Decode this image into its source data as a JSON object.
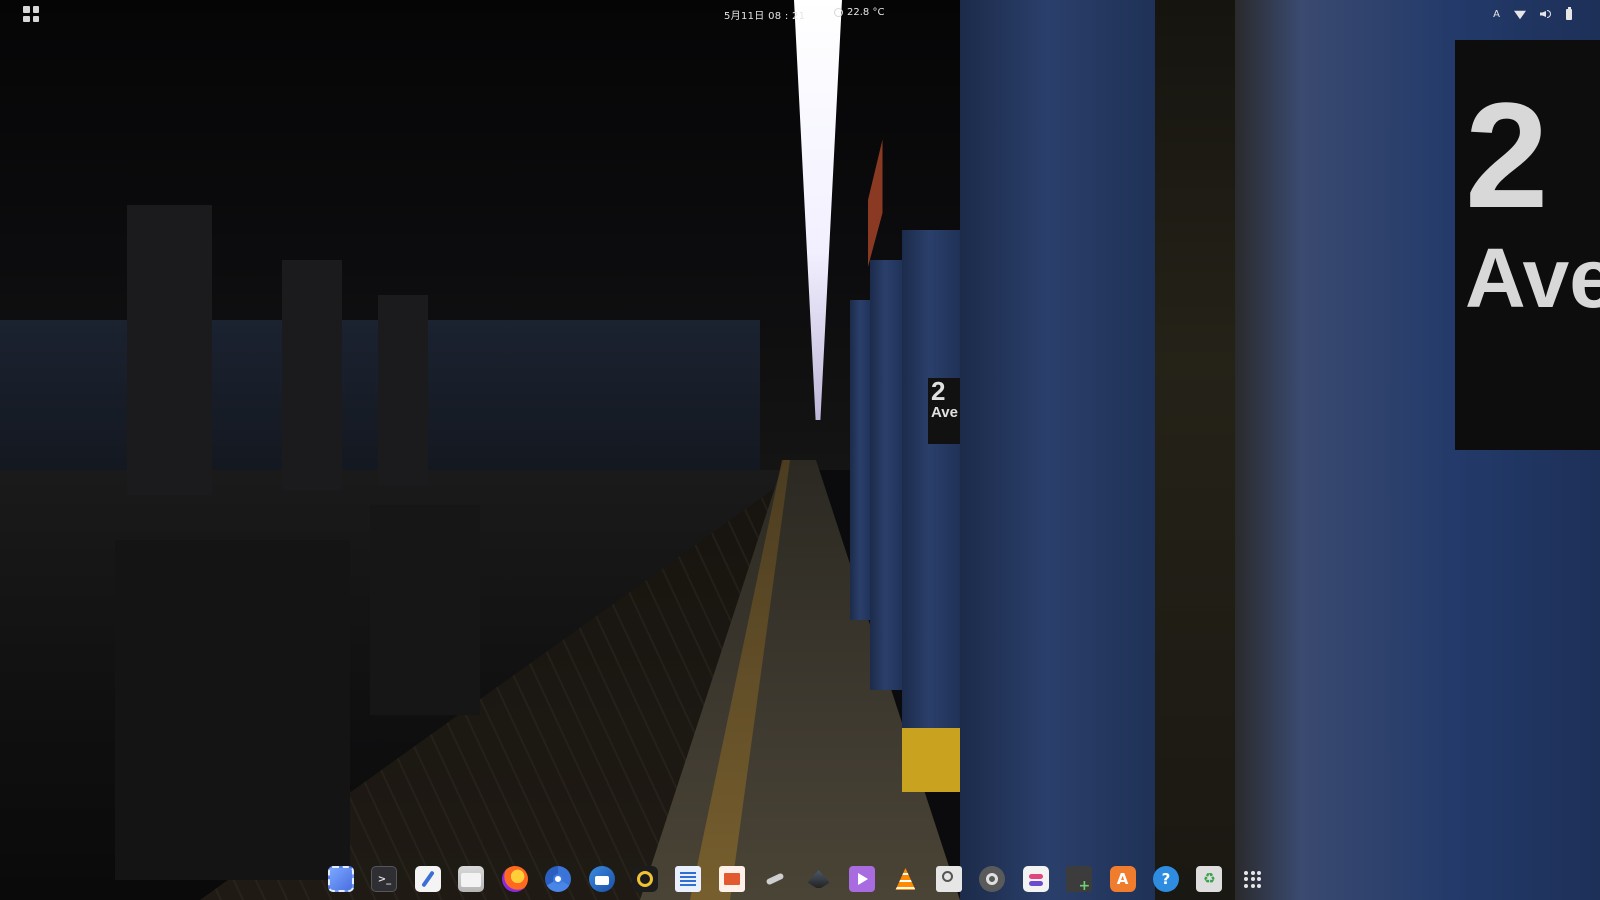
{
  "topbar": {
    "clock": "5月11日 08 : 21",
    "weather_temp": "22.8 °C",
    "weather_icon": "weather-icon",
    "input_method": "A",
    "tray_icons": [
      "wifi-icon",
      "volume-icon",
      "battery-icon"
    ]
  },
  "wallpaper": {
    "sign_number": "2",
    "sign_text": "Ave"
  },
  "dock": {
    "items": [
      {
        "name": "screenshot-icon"
      },
      {
        "name": "terminal-icon",
        "glyph": ">_"
      },
      {
        "name": "text-editor-icon"
      },
      {
        "name": "files-icon"
      },
      {
        "name": "firefox-icon"
      },
      {
        "name": "chromium-icon"
      },
      {
        "name": "thunderbird-icon"
      },
      {
        "name": "rhythmbox-icon"
      },
      {
        "name": "libreoffice-writer-icon"
      },
      {
        "name": "libreoffice-impress-icon"
      },
      {
        "name": "passwords-keys-icon"
      },
      {
        "name": "inkscape-icon"
      },
      {
        "name": "video-player-icon"
      },
      {
        "name": "vlc-icon"
      },
      {
        "name": "image-viewer-icon"
      },
      {
        "name": "settings-icon"
      },
      {
        "name": "tweaks-icon"
      },
      {
        "name": "extension-addon-icon"
      },
      {
        "name": "software-store-icon",
        "glyph": "A"
      },
      {
        "name": "help-icon",
        "glyph": "?"
      },
      {
        "name": "trash-icon"
      },
      {
        "name": "show-apps-grid-icon"
      }
    ]
  },
  "colors": {
    "accent_blue": "#2a3f6b",
    "pillar_yellow": "#c9a21f",
    "light_strip": "#f2f0ff"
  }
}
